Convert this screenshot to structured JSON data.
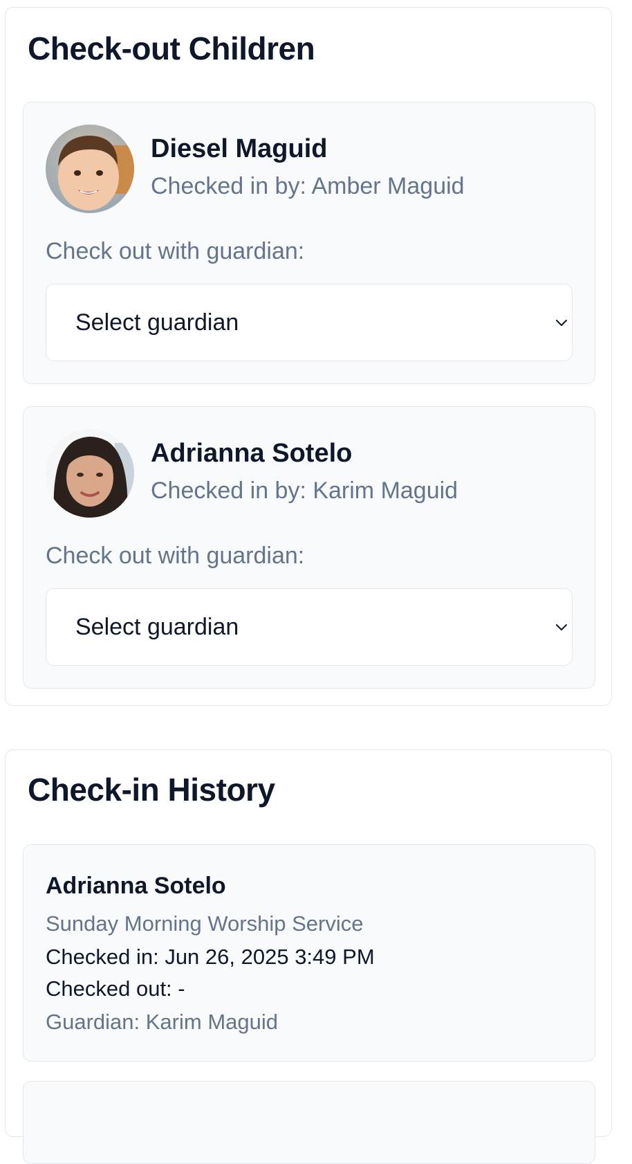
{
  "checkout": {
    "title": "Check-out Children",
    "children": [
      {
        "name": "Diesel Maguid",
        "checked_in_by": "Checked in by: Amber Maguid",
        "guardian_label": "Check out with guardian:",
        "select_value": "Select guardian",
        "avatar_icon": "child-photo-avatar"
      },
      {
        "name": "Adrianna Sotelo",
        "checked_in_by": "Checked in by: Karim Maguid",
        "guardian_label": "Check out with guardian:",
        "select_value": "Select guardian",
        "avatar_icon": "child-photo-avatar"
      }
    ]
  },
  "history": {
    "title": "Check-in History",
    "entries": [
      {
        "name": "Adrianna Sotelo",
        "event": "Sunday Morning Worship Service",
        "checked_in": "Checked in: Jun 26, 2025 3:49 PM",
        "checked_out": "Checked out: -",
        "guardian": "Guardian: Karim Maguid"
      }
    ]
  },
  "colors": {
    "text_primary": "#0f172a",
    "text_muted": "#64748b",
    "card_bg": "#f8fafc",
    "border": "#e2e8f0"
  }
}
